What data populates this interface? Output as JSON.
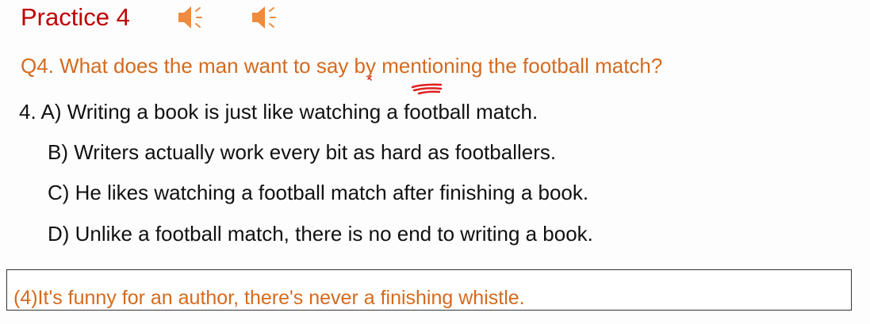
{
  "slide": {
    "title": "Practice 4",
    "question": "Q4. What does the man want to say by mentioning the football match?",
    "options": [
      "4. A) Writing a book is just like watching a football match.",
      "B) Writers actually work every bit as hard as footballers.",
      "C) He likes watching a football match after finishing a book.",
      "D) Unlike a football match, there is no end to writing a book."
    ],
    "transcript": "(4)It's funny for an author, there's never a finishing whistle."
  },
  "icons": {
    "audio_1": "speaker-icon",
    "audio_2": "speaker-icon"
  },
  "colors": {
    "title": "#c00000",
    "question": "#d46a1e",
    "transcript": "#d46a1e",
    "annotation": "#e02020",
    "speaker": "#f08a3c"
  }
}
